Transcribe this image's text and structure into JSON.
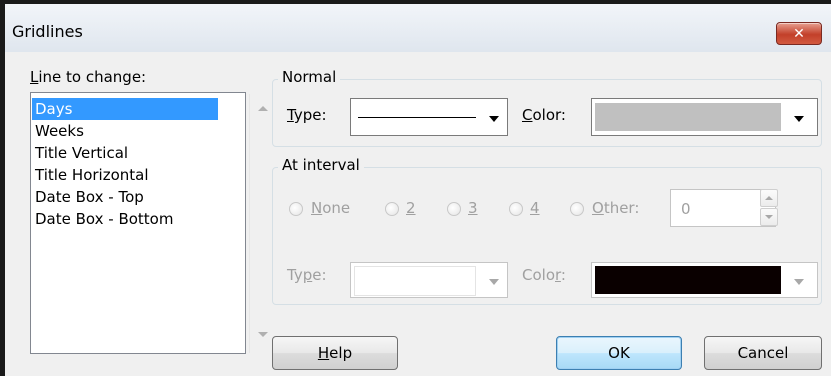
{
  "window": {
    "title": "Gridlines",
    "close_glyph": "✕"
  },
  "line_to_change": {
    "label_prefix": "",
    "label_accel": "L",
    "label_rest": "ine to change:",
    "items": [
      "Days",
      "Weeks",
      "Title Vertical",
      "Title Horizontal",
      "Date Box - Top",
      "Date Box - Bottom"
    ],
    "selected": "Days"
  },
  "normal": {
    "group_label": "Normal",
    "type_accel": "T",
    "type_rest": "ype:",
    "type_value": "solid line",
    "color_accel": "C",
    "color_rest": "olor:",
    "color_value": "#c0c0c0"
  },
  "at_interval": {
    "group_label": "At interval",
    "radios": [
      {
        "accel": "N",
        "rest": "one"
      },
      {
        "accel": "2",
        "rest": ""
      },
      {
        "accel": "3",
        "rest": ""
      },
      {
        "accel": "4",
        "rest": ""
      },
      {
        "accel": "O",
        "rest": "ther:"
      }
    ],
    "other_value": "0",
    "type_pre": "Ty",
    "type_accel": "p",
    "type_rest": "e:",
    "color_pre": "Colo",
    "color_accel": "r",
    "color_rest": ":",
    "color_value": "#0a0000"
  },
  "buttons": {
    "help_accel": "H",
    "help_rest": "elp",
    "ok": "OK",
    "cancel": "Cancel"
  },
  "icons": [
    "close-icon",
    "scroll-up-icon",
    "scroll-down-icon",
    "dropdown-arrow-icon",
    "spin-up-icon",
    "spin-down-icon"
  ]
}
